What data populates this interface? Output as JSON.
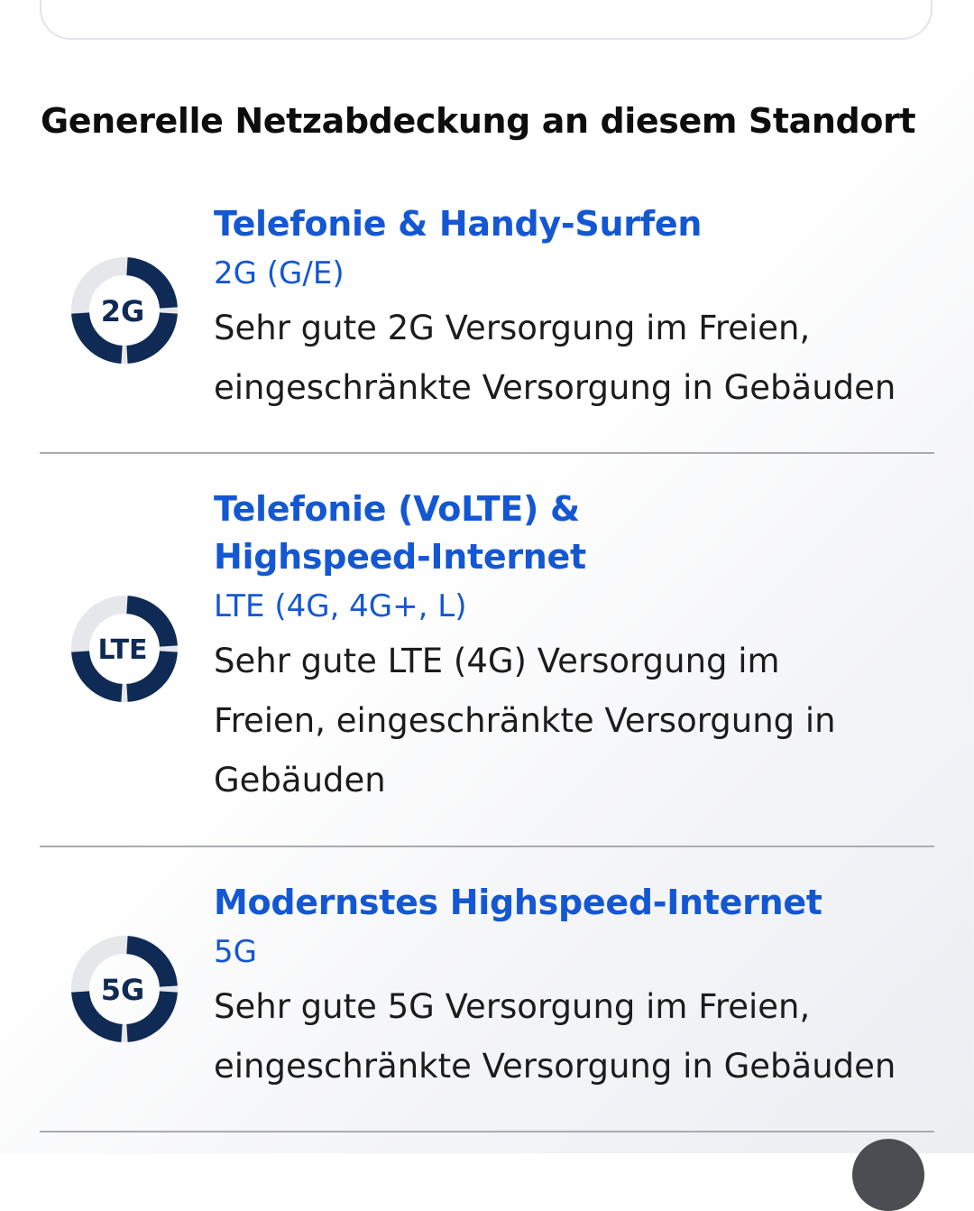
{
  "section": {
    "title": "Generelle Netzabdeckung an diesem Standort"
  },
  "coverage": [
    {
      "icon_label": "2G",
      "title": "Telefonie & Handy-Surfen",
      "tech": "2G (G/E)",
      "description": "Sehr gute 2G Versorgung im Freien, eingeschränkte Versorgung in Gebäuden",
      "signal_segments_filled": 3,
      "signal_segments_total": 4
    },
    {
      "icon_label": "LTE",
      "title": "Telefonie (VoLTE) & Highspeed-Internet",
      "tech": "LTE (4G, 4G+, L)",
      "description": "Sehr gute LTE (4G) Versorgung im Freien, eingeschränkte Versorgung in Gebäuden",
      "signal_segments_filled": 3,
      "signal_segments_total": 4
    },
    {
      "icon_label": "5G",
      "title": "Modernstes Highspeed-Internet",
      "tech": "5G",
      "description": "Sehr gute 5G Versorgung im Freien, eingeschränkte Versorgung in Gebäuden",
      "signal_segments_filled": 3,
      "signal_segments_total": 4
    }
  ],
  "colors": {
    "accent": "#1457d3",
    "icon_dark": "#0f2a55",
    "icon_track": "#e6e7ea",
    "divider": "#a9abae"
  }
}
